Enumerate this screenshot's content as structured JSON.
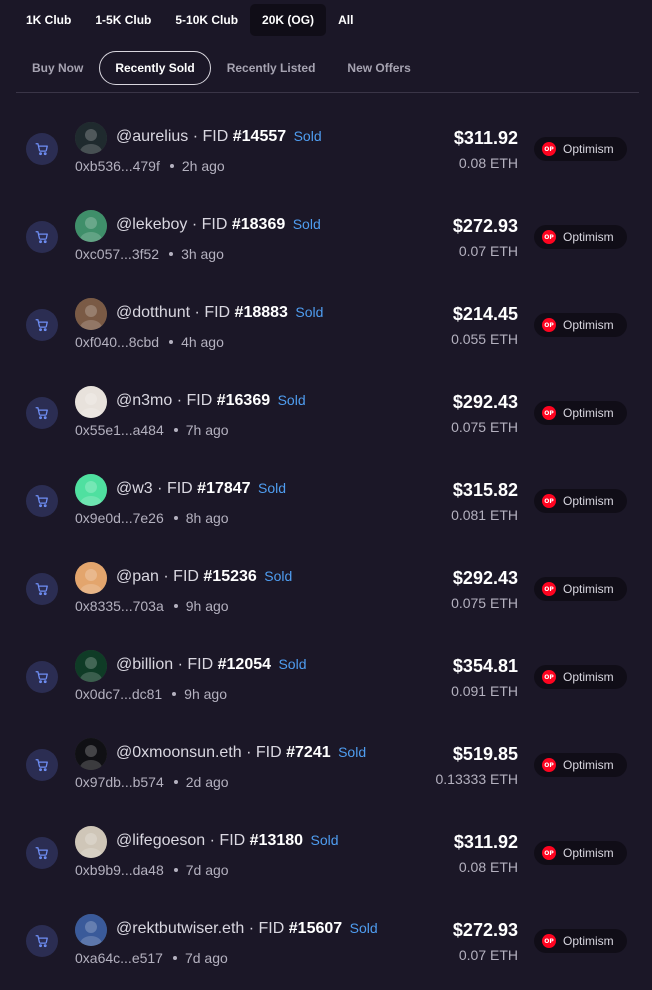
{
  "club_tabs": [
    {
      "label": "1K Club",
      "active": false
    },
    {
      "label": "1-5K Club",
      "active": false
    },
    {
      "label": "5-10K Club",
      "active": false
    },
    {
      "label": "20K (OG)",
      "active": true
    },
    {
      "label": "All",
      "active": false
    }
  ],
  "sub_tabs": [
    {
      "label": "Buy Now",
      "active": false
    },
    {
      "label": "Recently Sold",
      "active": true
    },
    {
      "label": "Recently Listed",
      "active": false
    },
    {
      "label": "New Offers",
      "active": false
    }
  ],
  "fid_label": "FID",
  "chain_icon_text": "OP",
  "listings": [
    {
      "handle": "@aurelius",
      "fid": "#14557",
      "status": "Sold",
      "address": "0xb536...479f",
      "time": "2h ago",
      "usd": "$311.92",
      "eth": "0.08 ETH",
      "chain": "Optimism",
      "avatar_color": "#1f2a2e"
    },
    {
      "handle": "@lekeboy",
      "fid": "#18369",
      "status": "Sold",
      "address": "0xc057...3f52",
      "time": "3h ago",
      "usd": "$272.93",
      "eth": "0.07 ETH",
      "chain": "Optimism",
      "avatar_color": "#3f8f6a"
    },
    {
      "handle": "@dotthunt",
      "fid": "#18883",
      "status": "Sold",
      "address": "0xf040...8cbd",
      "time": "4h ago",
      "usd": "$214.45",
      "eth": "0.055 ETH",
      "chain": "Optimism",
      "avatar_color": "#7a5a45"
    },
    {
      "handle": "@n3mo",
      "fid": "#16369",
      "status": "Sold",
      "address": "0x55e1...a484",
      "time": "7h ago",
      "usd": "$292.43",
      "eth": "0.075 ETH",
      "chain": "Optimism",
      "avatar_color": "#e8e2dc"
    },
    {
      "handle": "@w3",
      "fid": "#17847",
      "status": "Sold",
      "address": "0x9e0d...7e26",
      "time": "8h ago",
      "usd": "$315.82",
      "eth": "0.081 ETH",
      "chain": "Optimism",
      "avatar_color": "#4fe0a0"
    },
    {
      "handle": "@pan",
      "fid": "#15236",
      "status": "Sold",
      "address": "0x8335...703a",
      "time": "9h ago",
      "usd": "$292.43",
      "eth": "0.075 ETH",
      "chain": "Optimism",
      "avatar_color": "#e3a56d"
    },
    {
      "handle": "@billion",
      "fid": "#12054",
      "status": "Sold",
      "address": "0x0dc7...dc81",
      "time": "9h ago",
      "usd": "$354.81",
      "eth": "0.091 ETH",
      "chain": "Optimism",
      "avatar_color": "#0f3b26"
    },
    {
      "handle": "@0xmoonsun.eth",
      "fid": "#7241",
      "status": "Sold",
      "address": "0x97db...b574",
      "time": "2d ago",
      "usd": "$519.85",
      "eth": "0.13333 ETH",
      "chain": "Optimism",
      "avatar_color": "#101014"
    },
    {
      "handle": "@lifegoeson",
      "fid": "#13180",
      "status": "Sold",
      "address": "0xb9b9...da48",
      "time": "7d ago",
      "usd": "$311.92",
      "eth": "0.08 ETH",
      "chain": "Optimism",
      "avatar_color": "#cfc6b8"
    },
    {
      "handle": "@rektbutwiser.eth",
      "fid": "#15607",
      "status": "Sold",
      "address": "0xa64c...e517",
      "time": "7d ago",
      "usd": "$272.93",
      "eth": "0.07 ETH",
      "chain": "Optimism",
      "avatar_color": "#3a5a9a"
    }
  ]
}
